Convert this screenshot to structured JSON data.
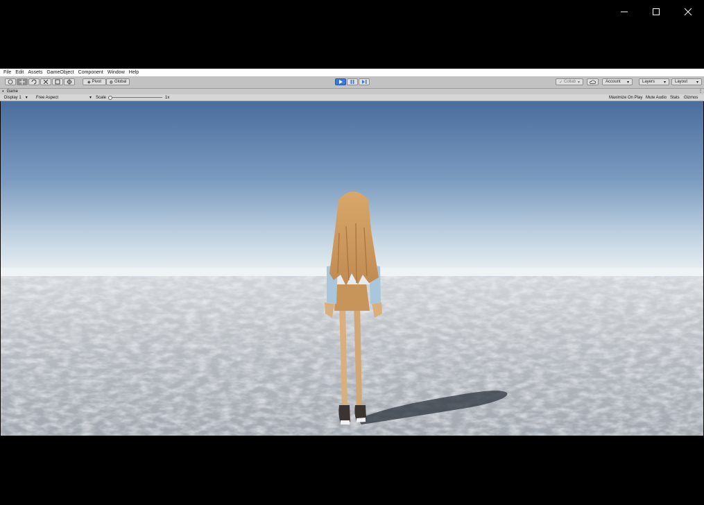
{
  "window": {
    "minimize_icon": "minimize-icon",
    "maximize_icon": "maximize-icon",
    "close_icon": "close-icon"
  },
  "menu": [
    "File",
    "Edit",
    "Assets",
    "GameObject",
    "Component",
    "Window",
    "Help"
  ],
  "toolbar": {
    "pivot_label": "Pivot",
    "global_label": "Global",
    "collab_label": "Collab",
    "account_label": "Account",
    "layers_label": "Layers",
    "layout_label": "Layout"
  },
  "tab": {
    "label": "Game"
  },
  "gamebar": {
    "display_label": "Display 1",
    "aspect_label": "Free Aspect",
    "scale_label": "Scale",
    "scale_value": "1x",
    "maximize_label": "Maximize On Play",
    "mute_label": "Mute Audio",
    "stats_label": "Stats",
    "gizmos_label": "Gizmos"
  },
  "colors": {
    "play_active": "#3d78d6",
    "sky_top": "#4b6f9f",
    "sky_horizon": "#e6eef2",
    "ground": "#b8bcc2"
  }
}
